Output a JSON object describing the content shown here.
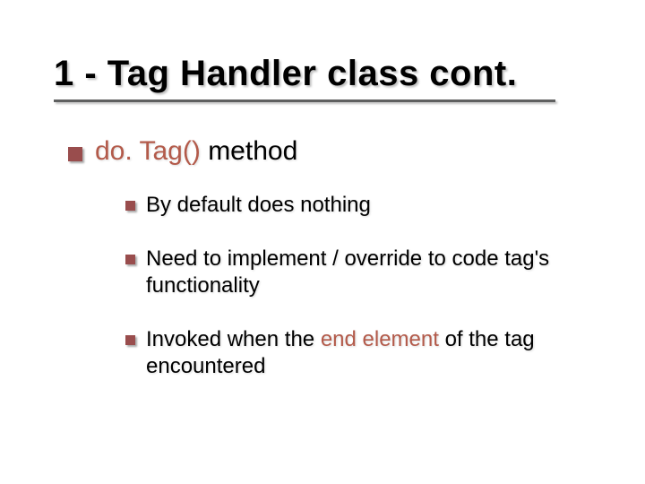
{
  "title": "1 - Tag Handler class cont.",
  "bullet1": {
    "accent": "do. Tag()",
    "rest": " method"
  },
  "sub": [
    {
      "text": "By default does nothing"
    },
    {
      "text": "Need to implement / override to code tag's functionality"
    },
    {
      "pre": "Invoked when the ",
      "accent": "end element",
      "post": " of the tag encountered"
    }
  ]
}
